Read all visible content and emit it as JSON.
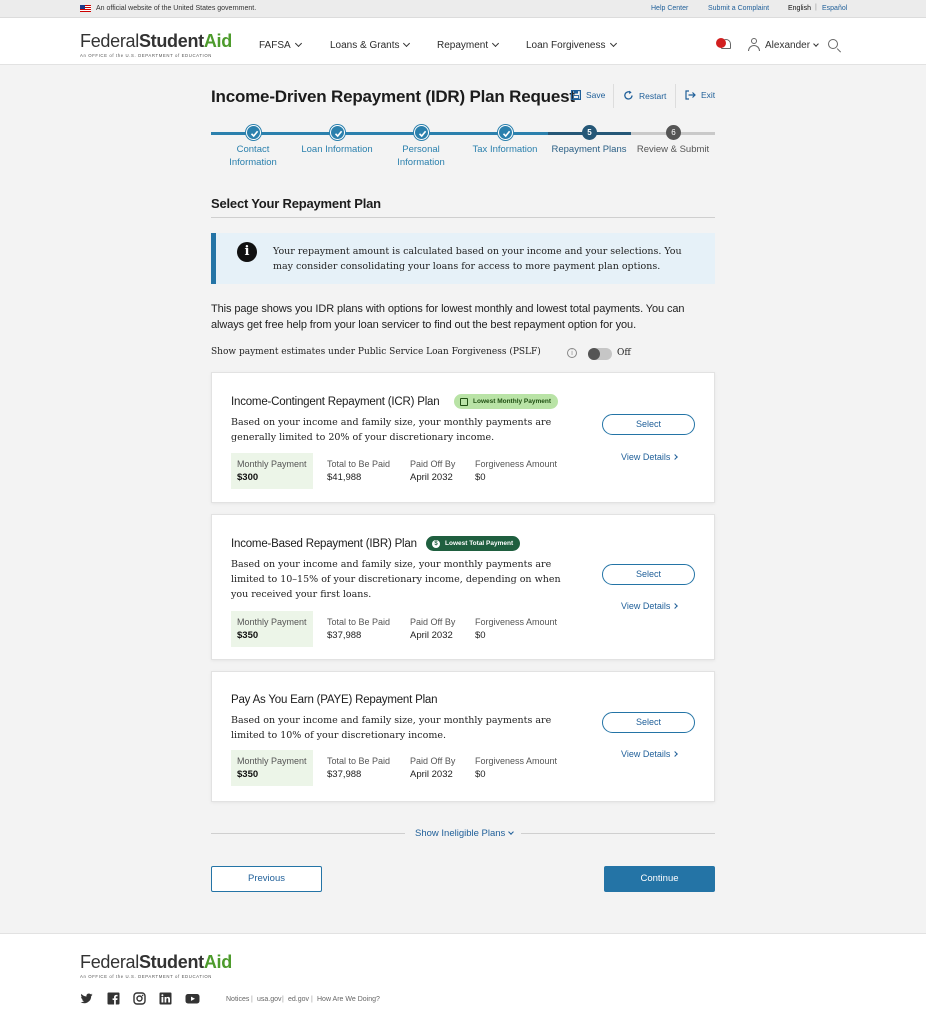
{
  "gov_banner": {
    "text": "An official website of the United States government.",
    "links": {
      "help": "Help Center",
      "complaint": "Submit a Complaint",
      "english": "English",
      "separator": "|",
      "spanish": "Español"
    }
  },
  "header": {
    "logo": {
      "federal": "Federal",
      "student": "Student",
      "aid": "Aid",
      "subtitle": "An OFFICE of the U.S. DEPARTMENT of EDUCATION"
    },
    "nav": [
      "FAFSA",
      "Loans & Grants",
      "Repayment",
      "Loan Forgiveness"
    ],
    "user": "Alexander"
  },
  "page": {
    "title": "Income-Driven Repayment (IDR) Plan Request",
    "actions": {
      "save": "Save",
      "restart": "Restart",
      "exit": "Exit"
    }
  },
  "stepper": {
    "steps": [
      {
        "label": "Contact Information",
        "status": "done"
      },
      {
        "label": "Loan Information",
        "status": "done"
      },
      {
        "label": "Personal Information",
        "status": "done"
      },
      {
        "label": "Tax Information",
        "status": "done"
      },
      {
        "number": "5",
        "label": "Repayment Plans",
        "status": "current"
      },
      {
        "number": "6",
        "label": "Review & Submit",
        "status": "todo"
      }
    ]
  },
  "section": {
    "title": "Select Your Repayment Plan"
  },
  "info_box": {
    "icon": "info-icon",
    "text": "Your repayment amount is calculated based on your income and your selections. You may consider consolidating your loans for access to more payment plan options."
  },
  "intro": "This page shows you IDR plans with options for lowest monthly and lowest total payments. You can always get free help from your loan servicer to find out the best repayment option for you.",
  "pslf": {
    "label": "Show payment estimates under Public Service Loan Forgiveness (PSLF)",
    "toggle_state": "Off"
  },
  "stat_labels": {
    "monthly": "Monthly Payment",
    "total": "Total to Be Paid",
    "paid_off": "Paid Off By",
    "forgiveness": "Forgiveness Amount"
  },
  "plans": [
    {
      "name": "Income-Contingent Repayment (ICR) Plan",
      "badge": "Lowest Monthly Payment",
      "description": "Based on your income and family size, your monthly payments are generally limited to 20% of your discretionary income.",
      "monthly": "$300",
      "total": "$41,988",
      "paid_off": "April 2032",
      "forgiveness": "$0",
      "select": "Select",
      "details": "View Details"
    },
    {
      "name": "Income-Based Repayment (IBR) Plan",
      "badge": "Lowest Total Payment",
      "badge_icon": "$",
      "description": "Based on your income and family size, your monthly payments are limited to 10–15% of your discretionary income, depending on when you received your first loans.",
      "monthly": "$350",
      "total": "$37,988",
      "paid_off": "April 2032",
      "forgiveness": "$0",
      "select": "Select",
      "details": "View Details"
    },
    {
      "name": "Pay As You Earn (PAYE) Repayment Plan",
      "description": "Based on your income and family size, your monthly payments are limited to 10% of your discretionary income.",
      "monthly": "$350",
      "total": "$37,988",
      "paid_off": "April 2032",
      "forgiveness": "$0",
      "select": "Select",
      "details": "View Details"
    }
  ],
  "ineligible": "Show Ineligible Plans",
  "buttons": {
    "previous": "Previous",
    "continue": "Continue"
  },
  "footer": {
    "links": [
      "Notices",
      "usa.gov",
      "ed.gov",
      "How Are We Doing?"
    ],
    "separator": "|",
    "social": [
      "twitter-icon",
      "facebook-icon",
      "instagram-icon",
      "linkedin-icon",
      "youtube-icon"
    ]
  },
  "colors": {
    "primary": "#2474a6",
    "brand_green": "#4d9b2c",
    "badge_green": "#b9e3a6",
    "badge_dark": "#1f5f3f",
    "alert": "#d21f1f"
  }
}
